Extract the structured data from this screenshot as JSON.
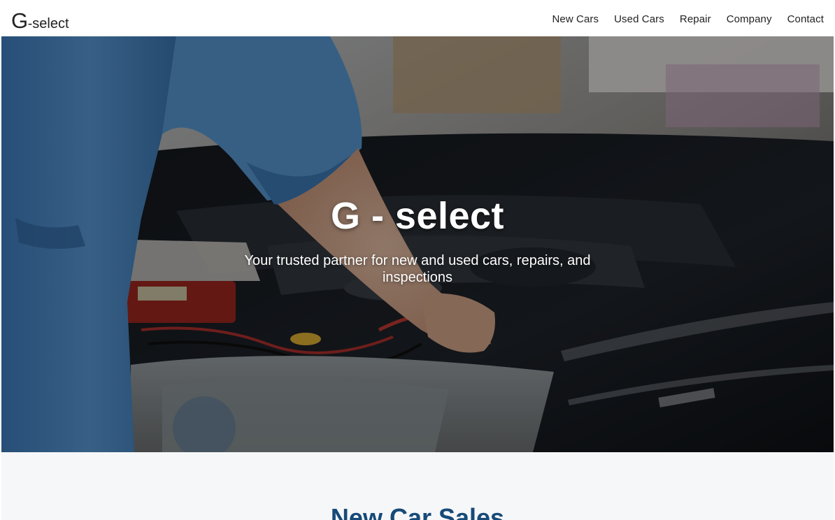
{
  "header": {
    "logo_mark": "G",
    "logo_rest": "-select",
    "nav": [
      {
        "label": "New Cars"
      },
      {
        "label": "Used Cars"
      },
      {
        "label": "Repair"
      },
      {
        "label": "Company"
      },
      {
        "label": "Contact"
      }
    ]
  },
  "hero": {
    "title": "G - select",
    "subtitle": "Your trusted partner for new and used cars, repairs, and inspections"
  },
  "section": {
    "title": "New Car Sales"
  },
  "colors": {
    "section_title": "#174a78",
    "section_bg": "#f6f7f9",
    "uniform_blue": "#4f8fcf"
  },
  "icons": {
    "hero_image": "mechanic-engine-photo"
  }
}
